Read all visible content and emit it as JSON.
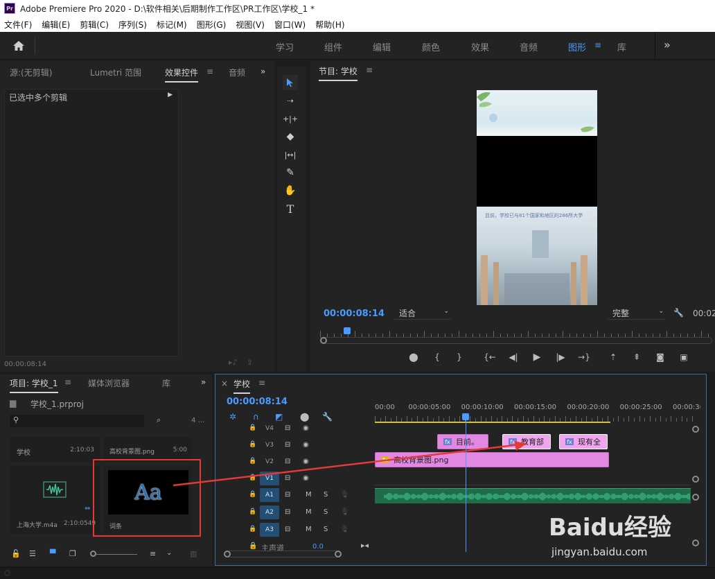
{
  "window": {
    "title": "Adobe Premiere Pro 2020 - D:\\软件相关\\后期制作工作区\\PR工作区\\学校_1 *"
  },
  "menu": [
    "文件(F)",
    "编辑(E)",
    "剪辑(C)",
    "序列(S)",
    "标记(M)",
    "图形(G)",
    "视图(V)",
    "窗口(W)",
    "帮助(H)"
  ],
  "workspaces": {
    "tabs": [
      "学习",
      "组件",
      "编辑",
      "颜色",
      "效果",
      "音频",
      "图形",
      "库"
    ],
    "active": "图形",
    "more": "»"
  },
  "source_panel": {
    "tabs": [
      "源:(无剪辑)",
      "Lumetri 范围",
      "效果控件",
      "音频"
    ],
    "active_tab": "效果控件",
    "menu_glyph": "≡",
    "more": "»",
    "message": "已选中多个剪辑",
    "timecode": "00:00:08:14"
  },
  "program_monitor": {
    "title": "节目: 学校",
    "menu_glyph": "≡",
    "timecode": "00:00:08:14",
    "fit": "适合",
    "resolution": "完整",
    "duration_partial": "00:02",
    "caption": "目前，学校已与81个国家和地区的286所大学",
    "playhead_fraction": 0.07
  },
  "project_panel": {
    "tabs": [
      "项目: 学校_1",
      "媒体浏览器",
      "库"
    ],
    "active_tab": "项目: 学校_1",
    "menu_glyph": "≡",
    "more": "»",
    "project_file": "学校_1.prproj",
    "search_placeholder": "",
    "item_count": "4 ...",
    "items": [
      {
        "name": "学校",
        "duration": "2:10:03"
      },
      {
        "name": "高校背景图.png",
        "duration": "5:00"
      },
      {
        "name": "上海大学.m4a",
        "duration": "2:10:0549"
      },
      {
        "name": "词条",
        "duration": ""
      }
    ],
    "title_thumb_text": "Aa"
  },
  "timeline": {
    "title": "学校",
    "menu_glyph": "≡",
    "timecode": "00:00:08:14",
    "ruler": [
      "00:00",
      "00:00:05:00",
      "00:00:10:00",
      "00:00:15:00",
      "00:00:20:00",
      "00:00:25:00",
      "00:00:3("
    ],
    "video_tracks": [
      "V4",
      "V3",
      "V2",
      "V1"
    ],
    "audio_tracks": [
      "A1",
      "A2",
      "A3"
    ],
    "master_label": "主声道",
    "master_value": "0.0",
    "clips": {
      "v3": [
        "目前。",
        "教育部",
        "现有全"
      ],
      "v2": "高校背景图.png"
    },
    "playhead_seconds": 8.56,
    "duration_seconds": 30
  },
  "colors": {
    "accent": "#4c9aff",
    "clip_pink": "#e388e2",
    "audio_green": "#37a86e",
    "annotation_red": "#e53935"
  },
  "watermark": {
    "brand": "Baidu经验",
    "url": "jingyan.baidu.com"
  }
}
